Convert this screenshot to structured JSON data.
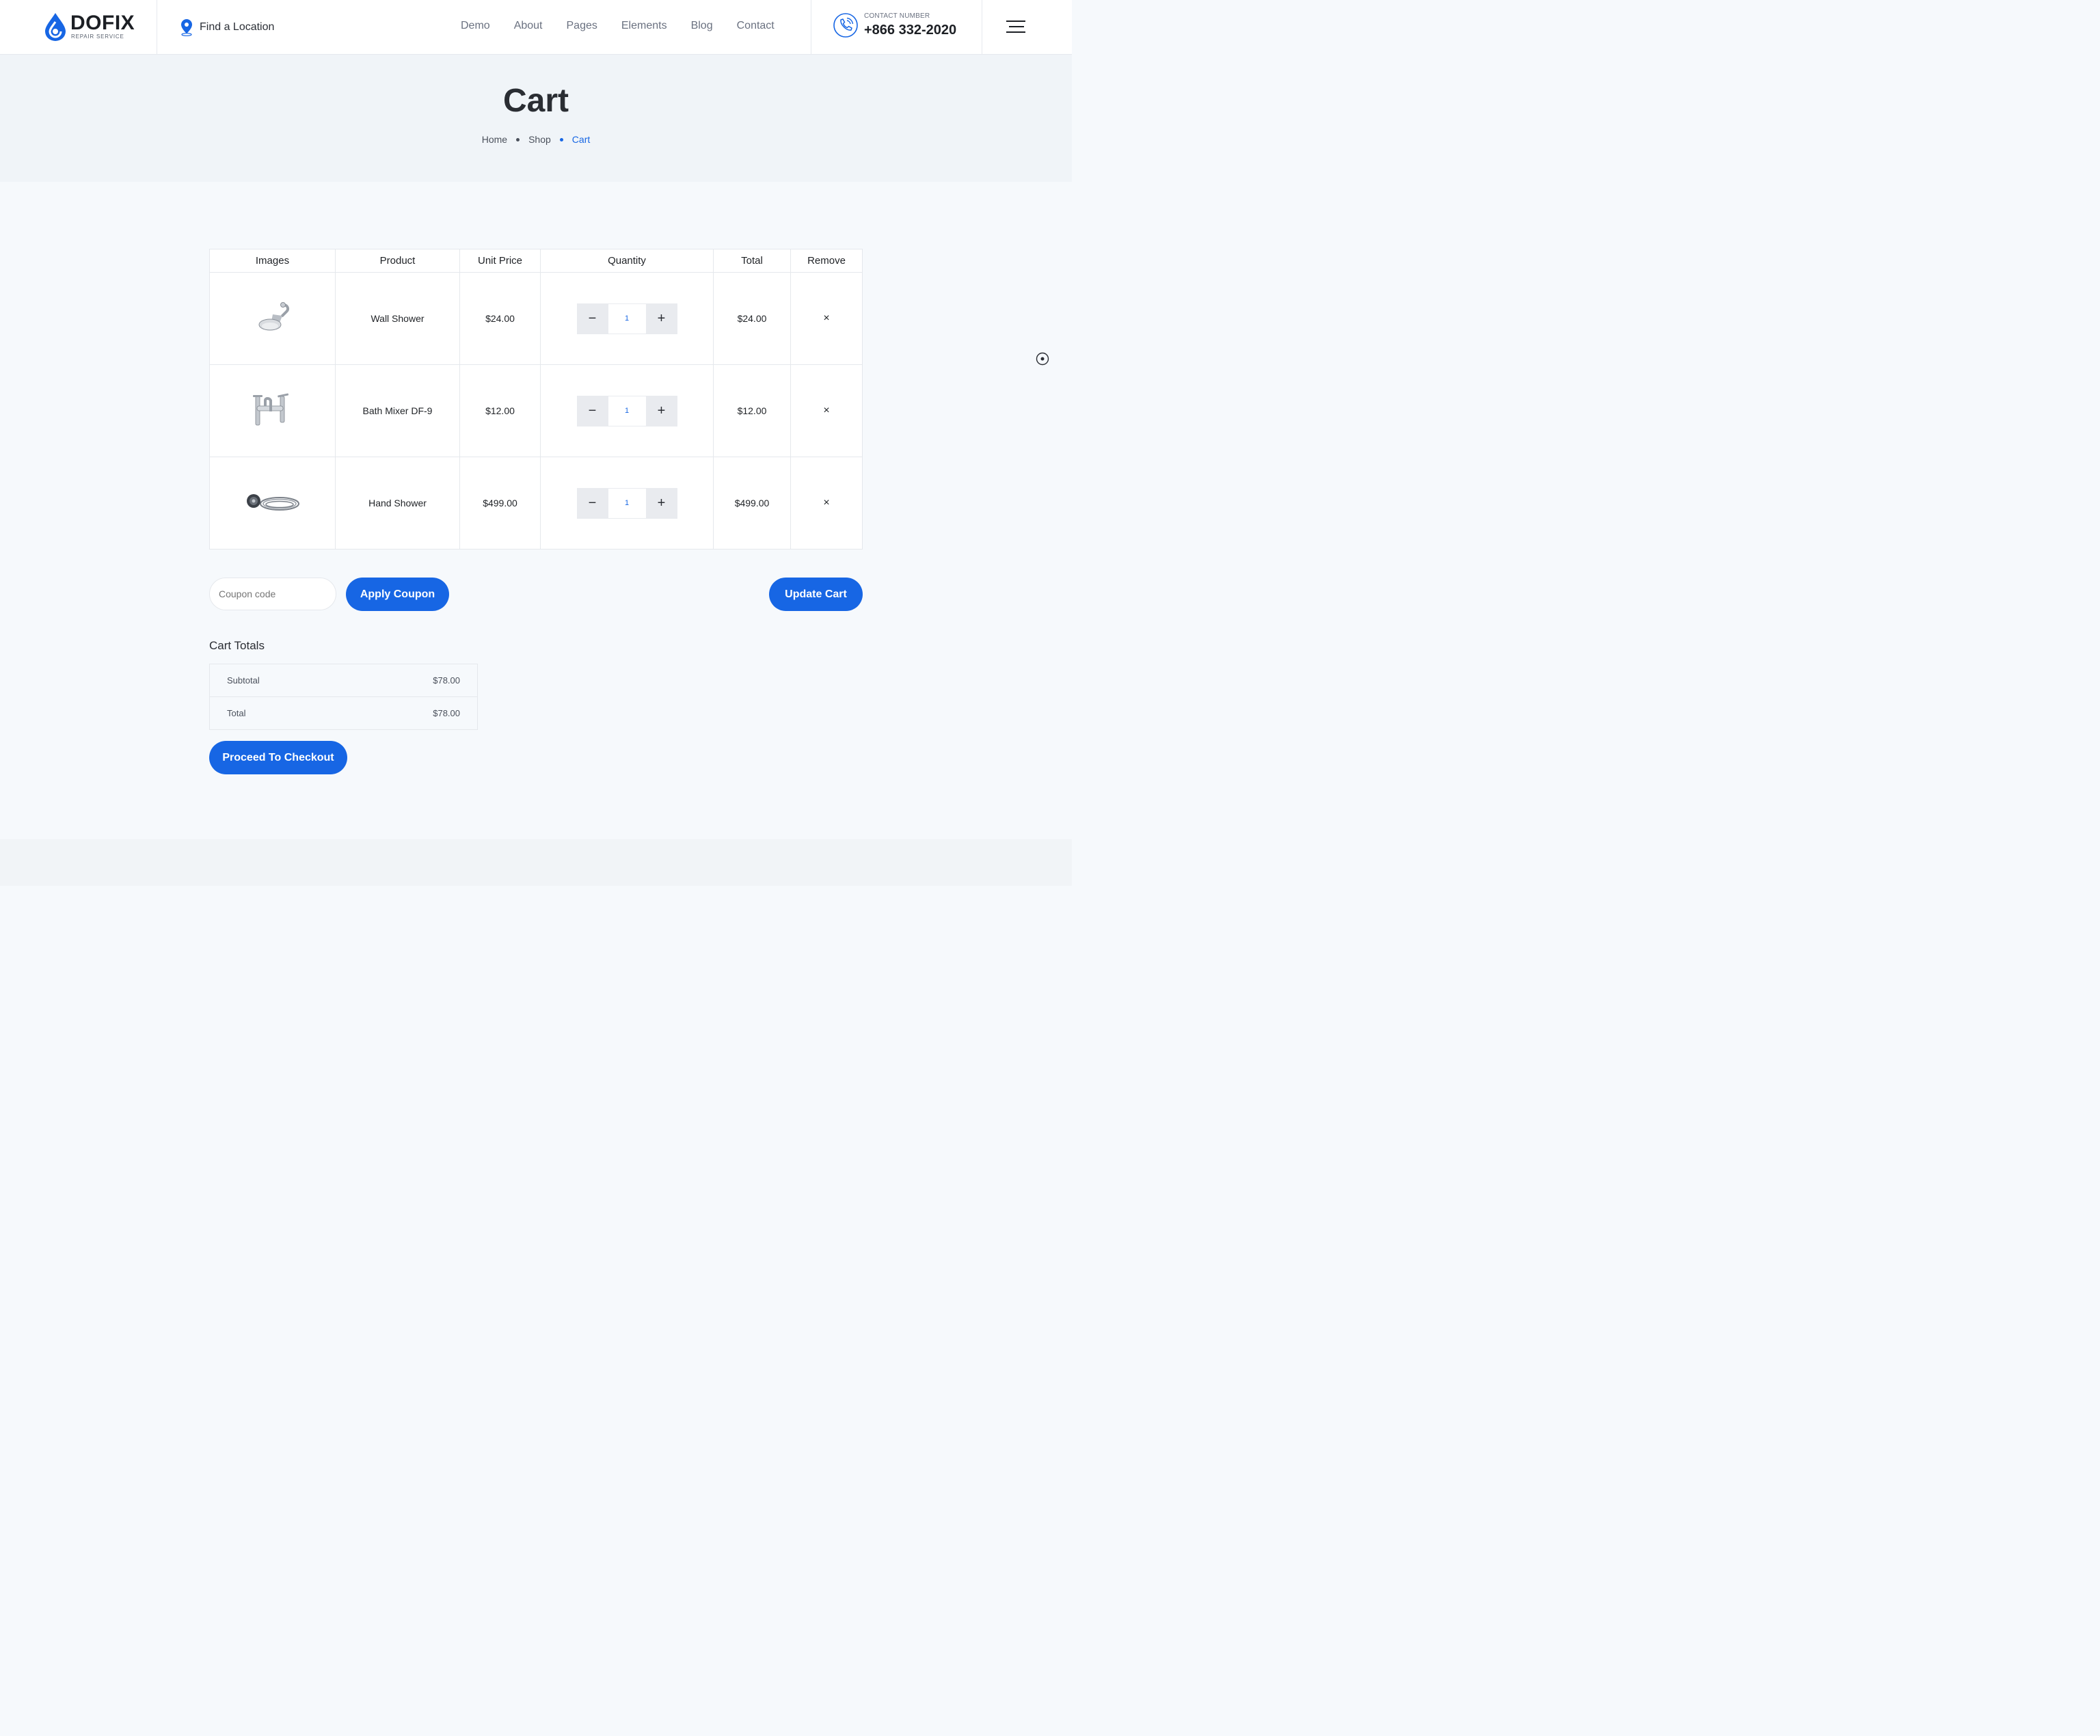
{
  "header": {
    "logo_name": "DOFIX",
    "logo_tagline": "REPAIR SERVICE",
    "find_location": "Find a Location",
    "nav": [
      "Demo",
      "About",
      "Pages",
      "Elements",
      "Blog",
      "Contact"
    ],
    "contact_label": "CONTACT NUMBER",
    "contact_number": "+866 332-2020"
  },
  "banner": {
    "title": "Cart",
    "breadcrumb": [
      "Home",
      "Shop",
      "Cart"
    ]
  },
  "cart": {
    "headers": [
      "Images",
      "Product",
      "Unit Price",
      "Quantity",
      "Total",
      "Remove"
    ],
    "items": [
      {
        "name": "Wall Shower",
        "image_icon": "wall-shower-image",
        "unit_price": "$24.00",
        "quantity": "1",
        "total": "$24.00",
        "remove": "×"
      },
      {
        "name": "Bath Mixer DF-9",
        "image_icon": "bath-mixer-image",
        "unit_price": "$12.00",
        "quantity": "1",
        "total": "$12.00",
        "remove": "×"
      },
      {
        "name": "Hand Shower",
        "image_icon": "hand-shower-image",
        "unit_price": "$499.00",
        "quantity": "1",
        "total": "$499.00",
        "remove": "×"
      }
    ],
    "qty_minus": "−",
    "qty_plus": "+"
  },
  "actions": {
    "coupon_placeholder": "Coupon code",
    "apply_coupon": "Apply Coupon",
    "update_cart": "Update Cart"
  },
  "totals": {
    "title": "Cart Totals",
    "subtotal_label": "Subtotal",
    "subtotal_value": "$78.00",
    "total_label": "Total",
    "total_value": "$78.00",
    "checkout": "Proceed To Checkout"
  },
  "colors": {
    "accent": "#1766e4",
    "page_bg": "#f6f9fc",
    "banner_bg": "#f0f4f8"
  }
}
